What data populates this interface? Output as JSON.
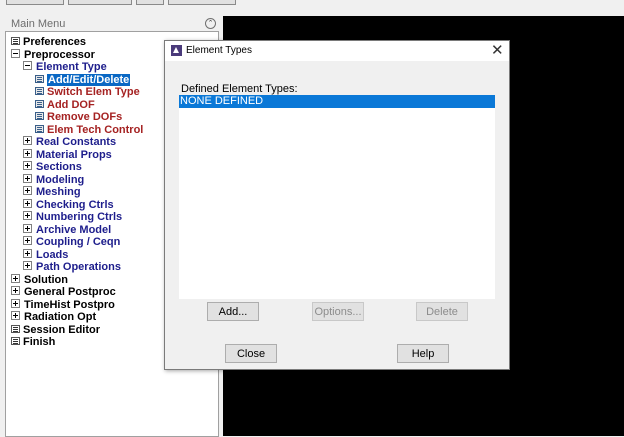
{
  "main_menu": {
    "title": "Main Menu",
    "items": [
      {
        "label": "Preferences"
      },
      {
        "label": "Preprocessor"
      },
      {
        "label": "Element Type"
      },
      {
        "label": "Add/Edit/Delete"
      },
      {
        "label": "Switch Elem Type"
      },
      {
        "label": "Add DOF"
      },
      {
        "label": "Remove DOFs"
      },
      {
        "label": "Elem Tech Control"
      },
      {
        "label": "Real Constants"
      },
      {
        "label": "Material Props"
      },
      {
        "label": "Sections"
      },
      {
        "label": "Modeling"
      },
      {
        "label": "Meshing"
      },
      {
        "label": "Checking Ctrls"
      },
      {
        "label": "Numbering Ctrls"
      },
      {
        "label": "Archive Model"
      },
      {
        "label": "Coupling / Ceqn"
      },
      {
        "label": "Loads"
      },
      {
        "label": "Path Operations"
      },
      {
        "label": "Solution"
      },
      {
        "label": "General Postproc"
      },
      {
        "label": "TimeHist Postpro"
      },
      {
        "label": "Radiation Opt"
      },
      {
        "label": "Session Editor"
      },
      {
        "label": "Finish"
      }
    ]
  },
  "dialog": {
    "title": "Element Types",
    "list_label": "Defined Element Types:",
    "list_items": [
      "NONE DEFINED"
    ],
    "add_label": "Add...",
    "options_label": "Options...",
    "delete_label": "Delete",
    "close_label": "Close",
    "help_label": "Help"
  },
  "colors": {
    "selection": "#0a78d7",
    "tree_blue": "#1e1e8c",
    "tree_red": "#a52222",
    "graphics_bg": "#000000"
  }
}
